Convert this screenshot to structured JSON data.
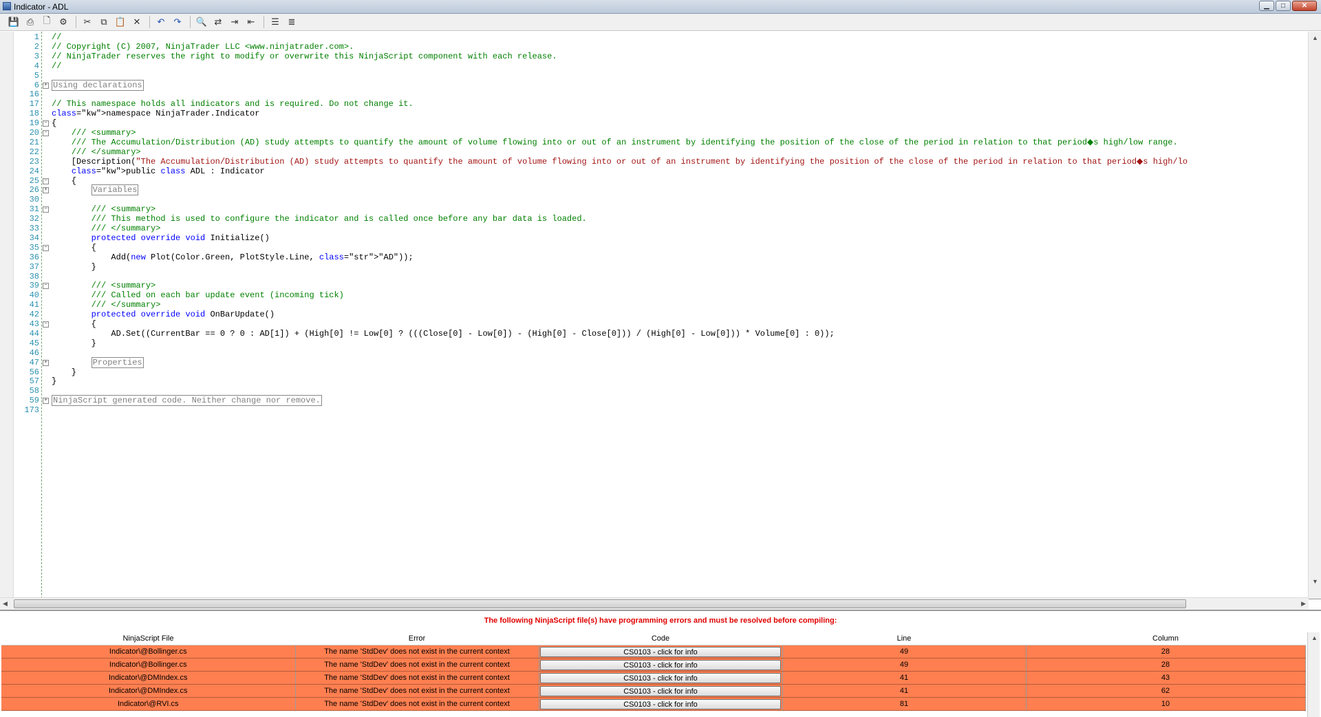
{
  "window": {
    "title": "Indicator - ADL"
  },
  "toolbar": {
    "icons": [
      "save-icon",
      "print-icon",
      "print-preview-icon",
      "page-setup-icon",
      "cut-icon",
      "copy-icon",
      "paste-icon",
      "delete-icon",
      "undo-icon",
      "redo-icon",
      "find-icon",
      "replace-icon",
      "indent-icon",
      "outdent-icon",
      "comment-icon",
      "uncomment-icon"
    ]
  },
  "editor": {
    "lines": [
      {
        "n": "1",
        "t": "//"
      },
      {
        "n": "2",
        "t": "// Copyright (C) 2007, NinjaTrader LLC <www.ninjatrader.com>."
      },
      {
        "n": "3",
        "t": "// NinjaTrader reserves the right to modify or overwrite this NinjaScript component with each release."
      },
      {
        "n": "4",
        "t": "//"
      },
      {
        "n": "5",
        "t": ""
      },
      {
        "n": "6",
        "t": "Using declarations"
      },
      {
        "n": "16",
        "t": ""
      },
      {
        "n": "17",
        "t": "// This namespace holds all indicators and is required. Do not change it."
      },
      {
        "n": "18",
        "t": "namespace NinjaTrader.Indicator"
      },
      {
        "n": "19",
        "t": "{"
      },
      {
        "n": "20",
        "t": "    /// <summary>"
      },
      {
        "n": "21",
        "t": "    /// The Accumulation/Distribution (AD) study attempts to quantify the amount of volume flowing into or out of an instrument by identifying the position of the close of the period in relation to that period◆s high/low range."
      },
      {
        "n": "22",
        "t": "    /// </summary>"
      },
      {
        "n": "23",
        "t": "    [Description(\"The Accumulation/Distribution (AD) study attempts to quantify the amount of volume flowing into or out of an instrument by identifying the position of the close of the period in relation to that period◆s high/lo"
      },
      {
        "n": "24",
        "t": "    public class ADL : Indicator"
      },
      {
        "n": "25",
        "t": "    {"
      },
      {
        "n": "26",
        "t": "        Variables"
      },
      {
        "n": "30",
        "t": ""
      },
      {
        "n": "31",
        "t": "        /// <summary>"
      },
      {
        "n": "32",
        "t": "        /// This method is used to configure the indicator and is called once before any bar data is loaded."
      },
      {
        "n": "33",
        "t": "        /// </summary>"
      },
      {
        "n": "34",
        "t": "        protected override void Initialize()"
      },
      {
        "n": "35",
        "t": "        {"
      },
      {
        "n": "36",
        "t": "            Add(new Plot(Color.Green, PlotStyle.Line, \"AD\"));"
      },
      {
        "n": "37",
        "t": "        }"
      },
      {
        "n": "38",
        "t": ""
      },
      {
        "n": "39",
        "t": "        /// <summary>"
      },
      {
        "n": "40",
        "t": "        /// Called on each bar update event (incoming tick)"
      },
      {
        "n": "41",
        "t": "        /// </summary>"
      },
      {
        "n": "42",
        "t": "        protected override void OnBarUpdate()"
      },
      {
        "n": "43",
        "t": "        {"
      },
      {
        "n": "44",
        "t": "            AD.Set((CurrentBar == 0 ? 0 : AD[1]) + (High[0] != Low[0] ? (((Close[0] - Low[0]) - (High[0] - Close[0])) / (High[0] - Low[0])) * Volume[0] : 0));"
      },
      {
        "n": "45",
        "t": "        }"
      },
      {
        "n": "46",
        "t": ""
      },
      {
        "n": "47",
        "t": "        Properties"
      },
      {
        "n": "56",
        "t": "    }"
      },
      {
        "n": "57",
        "t": "}"
      },
      {
        "n": "58",
        "t": ""
      },
      {
        "n": "59",
        "t": "NinjaScript generated code. Neither change nor remove."
      },
      {
        "n": "173",
        "t": ""
      }
    ]
  },
  "errors": {
    "message": "The following NinjaScript file(s) have programming errors and must be resolved before compiling:",
    "columns": [
      "NinjaScript File",
      "Error",
      "Code",
      "Line",
      "Column"
    ],
    "rows": [
      {
        "file": "Indicator\\@Bollinger.cs",
        "error": "The name 'StdDev' does not exist in the current context",
        "code": "CS0103 - click for info",
        "line": "49",
        "column": "28"
      },
      {
        "file": "Indicator\\@Bollinger.cs",
        "error": "The name 'StdDev' does not exist in the current context",
        "code": "CS0103 - click for info",
        "line": "49",
        "column": "28"
      },
      {
        "file": "Indicator\\@DMIndex.cs",
        "error": "The name 'StdDev' does not exist in the current context",
        "code": "CS0103 - click for info",
        "line": "41",
        "column": "43"
      },
      {
        "file": "Indicator\\@DMIndex.cs",
        "error": "The name 'StdDev' does not exist in the current context",
        "code": "CS0103 - click for info",
        "line": "41",
        "column": "62"
      },
      {
        "file": "Indicator\\@RVI.cs",
        "error": "The name 'StdDev' does not exist in the current context",
        "code": "CS0103 - click for info",
        "line": "81",
        "column": "10"
      }
    ]
  }
}
